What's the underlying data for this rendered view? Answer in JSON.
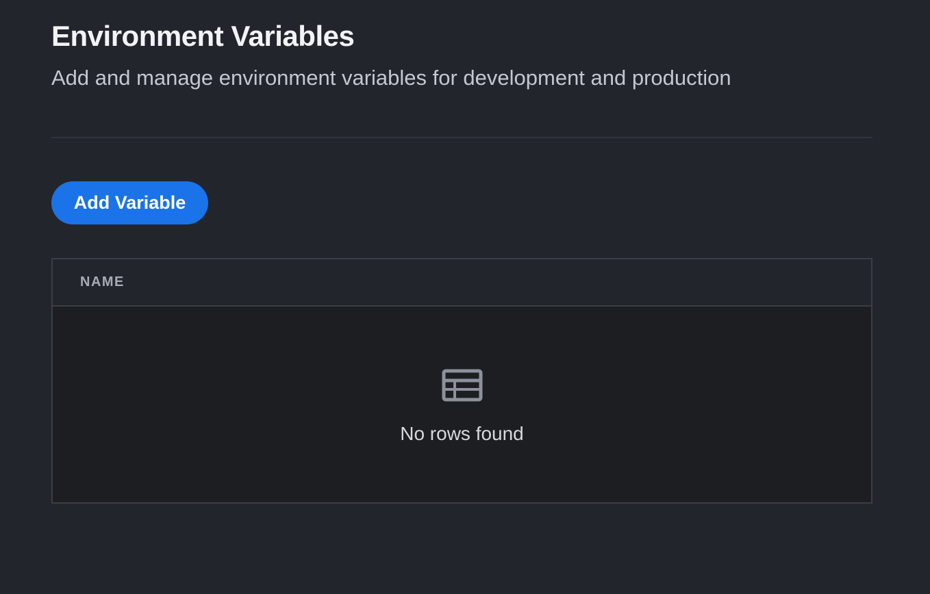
{
  "header": {
    "title": "Environment Variables",
    "subtitle": "Add and manage environment variables for development and production"
  },
  "actions": {
    "add_variable_label": "Add Variable"
  },
  "table": {
    "columns": [
      "NAME"
    ],
    "rows": [],
    "empty_state": {
      "icon": "table-icon",
      "message": "No rows found"
    }
  },
  "colors": {
    "background": "#22252c",
    "accent": "#1a73e8",
    "table_body": "#1d1e22",
    "border": "#3a3e46"
  }
}
